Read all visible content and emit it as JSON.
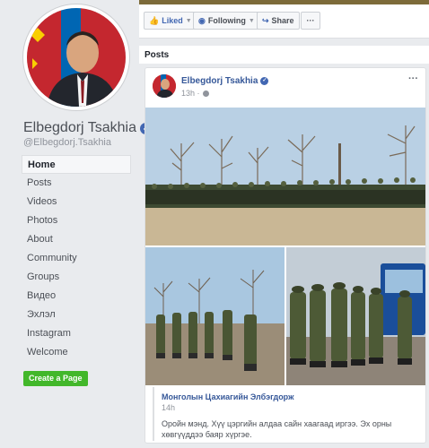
{
  "profile": {
    "name": "Elbegdorj Tsakhia",
    "handle": "@Elbegdorj.Tsakhia",
    "verified_icon": "verified-badge-icon"
  },
  "nav": {
    "items": [
      {
        "label": "Home",
        "active": true
      },
      {
        "label": "Posts"
      },
      {
        "label": "Videos"
      },
      {
        "label": "Photos"
      },
      {
        "label": "About"
      },
      {
        "label": "Community"
      },
      {
        "label": "Groups"
      },
      {
        "label": "Видео"
      },
      {
        "label": "Эхлэл"
      },
      {
        "label": "Instagram"
      },
      {
        "label": "Welcome"
      }
    ],
    "create_page": "Create a Page"
  },
  "actions": {
    "liked": "Liked",
    "following": "Following",
    "share": "Share",
    "more": "···"
  },
  "posts_section": {
    "title": "Posts"
  },
  "post": {
    "author": "Elbegdorj Tsakhia",
    "time": "13h ·",
    "menu": "···",
    "shared": {
      "name": "Монголын Цахиагийн Элбэгдорж",
      "time": "14h",
      "text": "Оройн мэнд. Хүү цэргийн алдаа сайн хаагаад иргээ. Эх орны хөвгүүддээ баяр хүргэе."
    }
  },
  "colors": {
    "brand": "#4267b2",
    "link": "#365899",
    "create_button": "#42b72a",
    "background": "#e9ebee"
  }
}
